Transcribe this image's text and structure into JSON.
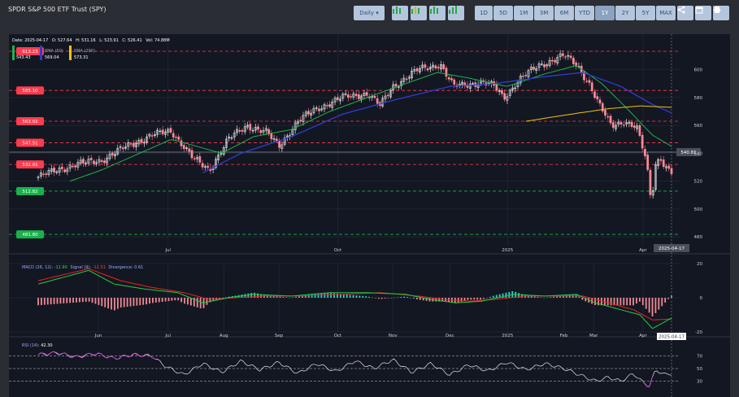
{
  "header": {
    "title": "SPDR S&P 500 ETF Trust (SPY)",
    "daily_label": "Daily ▾",
    "ranges": [
      "1D",
      "5D",
      "1M",
      "3M",
      "6M",
      "YTD",
      "1Y",
      "2Y",
      "5Y",
      "MAX"
    ],
    "active_range": "1Y"
  },
  "info": {
    "date": "Date: 2025-04-17",
    "open": "O: 527.64",
    "high": "H: 531.16",
    "low": "L: 523.91",
    "close": "C: 526.41",
    "vol": "Vol: 74.88M",
    "sma50": "SMA (50)",
    "sma200": "SMA (200)",
    "legend_a": "543.43",
    "legend_b": "569.04",
    "legend_c": "573.31"
  },
  "colors": {
    "up": "#26d07c",
    "down": "#ff5b6e",
    "sma20": "#22b14c",
    "sma50": "#2f3dd1",
    "sma200": "#f2c40f",
    "macd": "#22cc44",
    "signal": "#ee2222",
    "rsi_line": "#e6e6e6",
    "rsi_ob": "#d23fd2"
  },
  "chart_data": [
    {
      "type": "candlestick",
      "title": "",
      "xlabel": "",
      "ylabel": "",
      "ylim": [
        476,
        615
      ],
      "yticks": [
        "600",
        "580",
        "560",
        "540",
        "520",
        "500",
        "480"
      ],
      "xticks": [
        "Jul",
        "Oct",
        "2025",
        "Apr"
      ],
      "last_price": "540.81",
      "current_date": "2025-04-17",
      "levels": [
        {
          "value": 613.23,
          "label": "613.23",
          "color": "#ff3b4e"
        },
        {
          "value": 585.1,
          "label": "585.10",
          "color": "#ff3b4e"
        },
        {
          "value": 563.02,
          "label": "563.02",
          "color": "#ff3b4e"
        },
        {
          "value": 547.51,
          "label": "547.51",
          "color": "#ff3b4e"
        },
        {
          "value": 532.01,
          "label": "532.01",
          "color": "#ff3b4e"
        },
        {
          "value": 512.82,
          "label": "512.82",
          "color": "#18b24a"
        },
        {
          "value": 481.8,
          "label": "481.80",
          "color": "#18b24a"
        }
      ],
      "close_anchors": [
        {
          "t": 0.0,
          "v": 523
        },
        {
          "t": 0.03,
          "v": 528
        },
        {
          "t": 0.06,
          "v": 532
        },
        {
          "t": 0.1,
          "v": 535
        },
        {
          "t": 0.14,
          "v": 545
        },
        {
          "t": 0.18,
          "v": 553
        },
        {
          "t": 0.21,
          "v": 556
        },
        {
          "t": 0.23,
          "v": 545
        },
        {
          "t": 0.245,
          "v": 536
        },
        {
          "t": 0.27,
          "v": 528
        },
        {
          "t": 0.3,
          "v": 550
        },
        {
          "t": 0.33,
          "v": 560
        },
        {
          "t": 0.36,
          "v": 555
        },
        {
          "t": 0.38,
          "v": 545
        },
        {
          "t": 0.41,
          "v": 563
        },
        {
          "t": 0.44,
          "v": 572
        },
        {
          "t": 0.48,
          "v": 580
        },
        {
          "t": 0.52,
          "v": 583
        },
        {
          "t": 0.54,
          "v": 574
        },
        {
          "t": 0.56,
          "v": 588
        },
        {
          "t": 0.6,
          "v": 600
        },
        {
          "t": 0.635,
          "v": 604
        },
        {
          "t": 0.655,
          "v": 588
        },
        {
          "t": 0.7,
          "v": 591
        },
        {
          "t": 0.72,
          "v": 588
        },
        {
          "t": 0.735,
          "v": 580
        },
        {
          "t": 0.76,
          "v": 593
        },
        {
          "t": 0.79,
          "v": 603
        },
        {
          "t": 0.83,
          "v": 610
        },
        {
          "t": 0.85,
          "v": 604
        },
        {
          "t": 0.87,
          "v": 590
        },
        {
          "t": 0.885,
          "v": 575
        },
        {
          "t": 0.905,
          "v": 560
        },
        {
          "t": 0.925,
          "v": 563
        },
        {
          "t": 0.945,
          "v": 558
        },
        {
          "t": 0.96,
          "v": 535
        },
        {
          "t": 0.968,
          "v": 505
        },
        {
          "t": 0.975,
          "v": 533
        },
        {
          "t": 0.983,
          "v": 537
        },
        {
          "t": 0.99,
          "v": 530
        },
        {
          "t": 1.0,
          "v": 526
        }
      ],
      "sma50_anchors": [
        {
          "t": 0.26,
          "v": 526
        },
        {
          "t": 0.32,
          "v": 540
        },
        {
          "t": 0.4,
          "v": 552
        },
        {
          "t": 0.48,
          "v": 568
        },
        {
          "t": 0.56,
          "v": 578
        },
        {
          "t": 0.65,
          "v": 588
        },
        {
          "t": 0.72,
          "v": 590
        },
        {
          "t": 0.8,
          "v": 595
        },
        {
          "t": 0.86,
          "v": 598
        },
        {
          "t": 0.92,
          "v": 588
        },
        {
          "t": 0.97,
          "v": 575
        },
        {
          "t": 1.0,
          "v": 569
        }
      ],
      "sma200_anchors": [
        {
          "t": 0.77,
          "v": 563
        },
        {
          "t": 0.84,
          "v": 568
        },
        {
          "t": 0.9,
          "v": 572
        },
        {
          "t": 0.95,
          "v": 574
        },
        {
          "t": 1.0,
          "v": 573
        }
      ],
      "sma20_anchors": [
        {
          "t": 0.05,
          "v": 520
        },
        {
          "t": 0.1,
          "v": 528
        },
        {
          "t": 0.16,
          "v": 540
        },
        {
          "t": 0.21,
          "v": 550
        },
        {
          "t": 0.25,
          "v": 545
        },
        {
          "t": 0.29,
          "v": 540
        },
        {
          "t": 0.34,
          "v": 552
        },
        {
          "t": 0.4,
          "v": 557
        },
        {
          "t": 0.46,
          "v": 570
        },
        {
          "t": 0.52,
          "v": 580
        },
        {
          "t": 0.58,
          "v": 590
        },
        {
          "t": 0.63,
          "v": 598
        },
        {
          "t": 0.68,
          "v": 594
        },
        {
          "t": 0.74,
          "v": 588
        },
        {
          "t": 0.8,
          "v": 597
        },
        {
          "t": 0.85,
          "v": 603
        },
        {
          "t": 0.89,
          "v": 590
        },
        {
          "t": 0.93,
          "v": 572
        },
        {
          "t": 0.97,
          "v": 553
        },
        {
          "t": 1.0,
          "v": 545
        }
      ]
    },
    {
      "type": "macd",
      "title": "",
      "legend_label": "MACD (26, 12): ",
      "macd_value": "-11.90",
      "signal_label": "Signal (9): ",
      "signal_value": "-12.51",
      "div_label": "Divergence: ",
      "div_value": "0.61",
      "ylim": [
        -20,
        20
      ],
      "yticks": [
        "20",
        "0",
        "-20"
      ],
      "xticks": [
        "Jun",
        "Jul",
        "Aug",
        "Sep",
        "Oct",
        "Nov",
        "Dec",
        "2025",
        "Feb",
        "Mar",
        "Apr"
      ],
      "current_date": "2025-04-17",
      "macd_anchors": [
        {
          "t": 0.0,
          "v": 8
        },
        {
          "t": 0.08,
          "v": 16
        },
        {
          "t": 0.12,
          "v": 8
        },
        {
          "t": 0.17,
          "v": 5
        },
        {
          "t": 0.22,
          "v": 3
        },
        {
          "t": 0.26,
          "v": -3
        },
        {
          "t": 0.3,
          "v": 0
        },
        {
          "t": 0.34,
          "v": 2
        },
        {
          "t": 0.4,
          "v": 1
        },
        {
          "t": 0.46,
          "v": 3
        },
        {
          "t": 0.52,
          "v": 3
        },
        {
          "t": 0.58,
          "v": 2
        },
        {
          "t": 0.62,
          "v": -1
        },
        {
          "t": 0.66,
          "v": -3
        },
        {
          "t": 0.7,
          "v": -2
        },
        {
          "t": 0.75,
          "v": 2
        },
        {
          "t": 0.8,
          "v": 1
        },
        {
          "t": 0.85,
          "v": 2
        },
        {
          "t": 0.88,
          "v": -3
        },
        {
          "t": 0.92,
          "v": -7
        },
        {
          "t": 0.95,
          "v": -10
        },
        {
          "t": 0.97,
          "v": -18
        },
        {
          "t": 1.0,
          "v": -11.9
        }
      ],
      "signal_anchors": [
        {
          "t": 0.0,
          "v": 10
        },
        {
          "t": 0.08,
          "v": 17
        },
        {
          "t": 0.13,
          "v": 10
        },
        {
          "t": 0.18,
          "v": 6
        },
        {
          "t": 0.23,
          "v": 3
        },
        {
          "t": 0.27,
          "v": -1
        },
        {
          "t": 0.31,
          "v": 0
        },
        {
          "t": 0.36,
          "v": 1
        },
        {
          "t": 0.42,
          "v": 1
        },
        {
          "t": 0.48,
          "v": 2
        },
        {
          "t": 0.54,
          "v": 3
        },
        {
          "t": 0.6,
          "v": 1
        },
        {
          "t": 0.64,
          "v": -1
        },
        {
          "t": 0.68,
          "v": -2
        },
        {
          "t": 0.72,
          "v": -1
        },
        {
          "t": 0.77,
          "v": 1
        },
        {
          "t": 0.82,
          "v": 1
        },
        {
          "t": 0.86,
          "v": 1
        },
        {
          "t": 0.9,
          "v": -3
        },
        {
          "t": 0.94,
          "v": -7
        },
        {
          "t": 0.97,
          "v": -13
        },
        {
          "t": 1.0,
          "v": -12.5
        }
      ]
    },
    {
      "type": "rsi",
      "title": "",
      "legend_label": "RSI (14): ",
      "rsi_value": "42.30",
      "ylim": [
        10,
        90
      ],
      "yticks": [
        "70",
        "50",
        "30"
      ],
      "rsi_anchors": [
        {
          "t": 0.0,
          "v": 72
        },
        {
          "t": 0.03,
          "v": 75
        },
        {
          "t": 0.06,
          "v": 68
        },
        {
          "t": 0.09,
          "v": 74
        },
        {
          "t": 0.12,
          "v": 66
        },
        {
          "t": 0.15,
          "v": 72
        },
        {
          "t": 0.18,
          "v": 70
        },
        {
          "t": 0.2,
          "v": 54
        },
        {
          "t": 0.23,
          "v": 40
        },
        {
          "t": 0.26,
          "v": 58
        },
        {
          "t": 0.29,
          "v": 44
        },
        {
          "t": 0.32,
          "v": 62
        },
        {
          "t": 0.35,
          "v": 48
        },
        {
          "t": 0.38,
          "v": 60
        },
        {
          "t": 0.41,
          "v": 42
        },
        {
          "t": 0.44,
          "v": 58
        },
        {
          "t": 0.47,
          "v": 45
        },
        {
          "t": 0.5,
          "v": 62
        },
        {
          "t": 0.53,
          "v": 50
        },
        {
          "t": 0.56,
          "v": 64
        },
        {
          "t": 0.59,
          "v": 44
        },
        {
          "t": 0.62,
          "v": 58
        },
        {
          "t": 0.65,
          "v": 40
        },
        {
          "t": 0.68,
          "v": 56
        },
        {
          "t": 0.71,
          "v": 46
        },
        {
          "t": 0.74,
          "v": 60
        },
        {
          "t": 0.77,
          "v": 48
        },
        {
          "t": 0.8,
          "v": 58
        },
        {
          "t": 0.83,
          "v": 50
        },
        {
          "t": 0.86,
          "v": 38
        },
        {
          "t": 0.88,
          "v": 30
        },
        {
          "t": 0.9,
          "v": 36
        },
        {
          "t": 0.92,
          "v": 30
        },
        {
          "t": 0.94,
          "v": 42
        },
        {
          "t": 0.955,
          "v": 28
        },
        {
          "t": 0.965,
          "v": 22
        },
        {
          "t": 0.975,
          "v": 48
        },
        {
          "t": 0.99,
          "v": 40
        },
        {
          "t": 1.0,
          "v": 42
        }
      ]
    }
  ]
}
